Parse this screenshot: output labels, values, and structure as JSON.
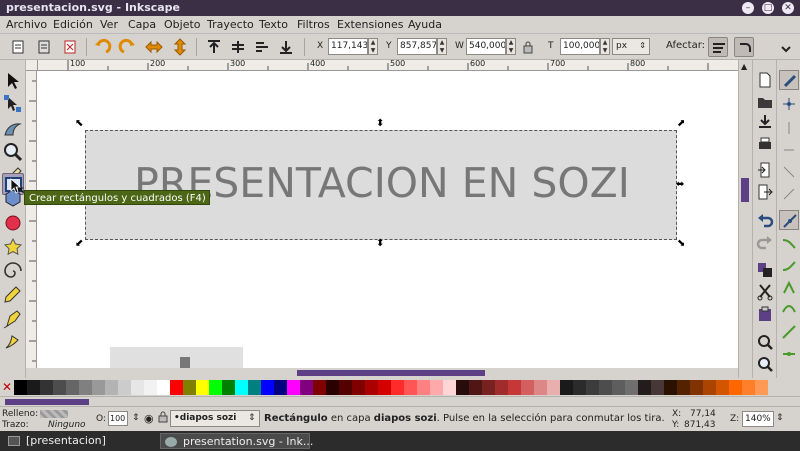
{
  "window": {
    "title": "presentacion.svg - Inkscape"
  },
  "menu": [
    "Archivo",
    "Edición",
    "Ver",
    "Capa",
    "Objeto",
    "Trayecto",
    "Texto",
    "Filtros",
    "Extensiones",
    "Ayuda"
  ],
  "controls": {
    "x_label": "X",
    "x_value": "117,143",
    "y_label": "Y",
    "y_value": "857,857",
    "w_label": "W",
    "w_value": "540,000",
    "h_label": "T",
    "h_value": "100,000",
    "unit": "px",
    "affect_label": "Afectar:"
  },
  "ruler_top": [
    "100",
    "200",
    "300",
    "400",
    "500",
    "600",
    "700",
    "800"
  ],
  "canvas": {
    "slide_text": "PRESENTACION EN SOZI"
  },
  "tooltip": "Crear rectángulos y cuadrados (F4)",
  "palette_colors": [
    "#000000",
    "#1a1a1a",
    "#333333",
    "#4d4d4d",
    "#666666",
    "#808080",
    "#999999",
    "#b3b3b3",
    "#cccccc",
    "#e6e6e6",
    "#f2f2f2",
    "#ffffff",
    "#ff0000",
    "#808000",
    "#ffff00",
    "#00ff00",
    "#008000",
    "#00ffff",
    "#008080",
    "#0000ff",
    "#000080",
    "#ff00ff",
    "#800080",
    "#800000",
    "#2b0000",
    "#550000",
    "#800000",
    "#aa0000",
    "#d40000",
    "#ff2a2a",
    "#ff5555",
    "#ff8080",
    "#ffaaaa",
    "#ffd5d5",
    "#280b0b",
    "#501616",
    "#782121",
    "#a02c2c",
    "#c83737",
    "#d35f5f",
    "#de8787",
    "#e9afaf",
    "#1a1a1a",
    "#2b2b2b",
    "#3c3c3c",
    "#4d4d4d",
    "#5e5e5e",
    "#6f6f6f",
    "#241c1c",
    "#483737",
    "#2b1100",
    "#552200",
    "#803300",
    "#aa4400",
    "#d45500",
    "#ff6600",
    "#ff7f2a",
    "#ff9955"
  ],
  "status": {
    "fill_label": "Relleno:",
    "stroke_label": "Trazo:",
    "stroke_value": "Ninguno",
    "opacity_label": "O:",
    "opacity_value": "100",
    "layer_name": "•diapos sozi",
    "message_bold1": "Rectángulo",
    "message_mid": " en capa ",
    "message_bold2": "diapos sozi",
    "message_end": ". Pulse en la selección para conmutar los tira.",
    "cursor_x_label": "X:",
    "cursor_x": "77,14",
    "cursor_y_label": "Y:",
    "cursor_y": "871,43",
    "zoom_label": "Z:",
    "zoom": "140%"
  },
  "taskbar": {
    "items": [
      "[presentacion]",
      "presentation.svg - Ink..."
    ]
  }
}
